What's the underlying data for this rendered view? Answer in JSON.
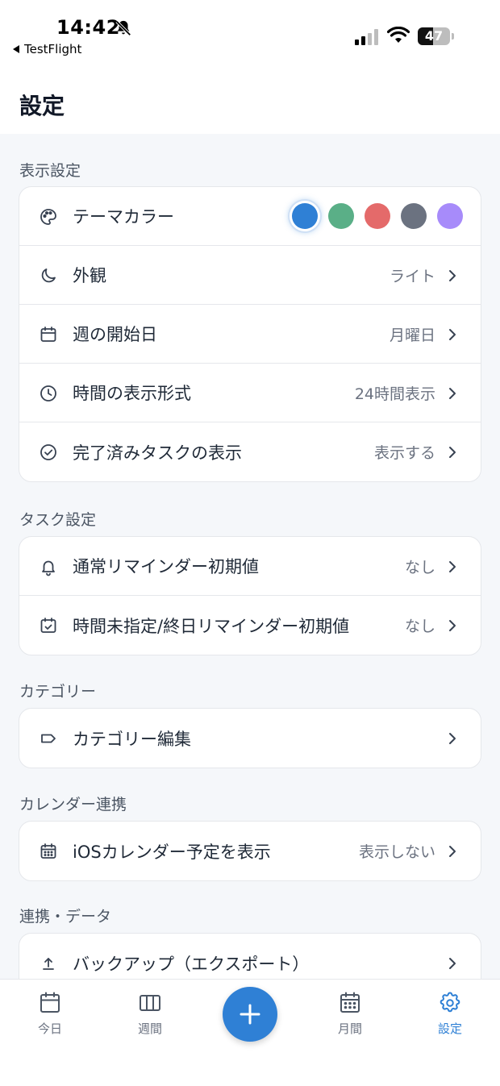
{
  "status_bar": {
    "time": "14:42",
    "back_app": "TestFlight",
    "battery_level": "47",
    "battery_fraction": 0.47
  },
  "header": {
    "title": "設定"
  },
  "sections": {
    "display": {
      "title": "表示設定",
      "theme_color": {
        "label": "テーマカラー",
        "icon": "palette-icon",
        "colors": [
          "#2f80d5",
          "#5aaf87",
          "#e46a6a",
          "#6b7280",
          "#a78bfa"
        ],
        "selected_index": 0
      },
      "appearance": {
        "label": "外観",
        "value": "ライト",
        "icon": "moon-icon"
      },
      "week_start": {
        "label": "週の開始日",
        "value": "月曜日",
        "icon": "calendar-icon"
      },
      "time_format": {
        "label": "時間の表示形式",
        "value": "24時間表示",
        "icon": "clock-icon"
      },
      "completed_tasks": {
        "label": "完了済みタスクの表示",
        "value": "表示する",
        "icon": "check-circle-icon"
      }
    },
    "task": {
      "title": "タスク設定",
      "reminder_default": {
        "label": "通常リマインダー初期値",
        "value": "なし",
        "icon": "bell-icon"
      },
      "allday_reminder_default": {
        "label": "時間未指定/終日リマインダー初期値",
        "value": "なし",
        "icon": "calendar-check-icon"
      }
    },
    "category": {
      "title": "カテゴリー",
      "edit": {
        "label": "カテゴリー編集",
        "icon": "tag-icon"
      }
    },
    "calendar": {
      "title": "カレンダー連携",
      "ios_calendar": {
        "label": "iOSカレンダー予定を表示",
        "value": "表示しない",
        "icon": "calendar-grid-icon"
      }
    },
    "data": {
      "title": "連携・データ",
      "backup": {
        "label": "バックアップ（エクスポート）",
        "icon": "upload-icon"
      }
    }
  },
  "tab_bar": {
    "accent": "#2f80d5",
    "today": {
      "label": "今日",
      "icon": "calendar-icon"
    },
    "week": {
      "label": "週間",
      "icon": "columns-icon"
    },
    "add": {
      "icon": "plus-icon"
    },
    "month": {
      "label": "月間",
      "icon": "calendar-grid-icon"
    },
    "settings": {
      "label": "設定",
      "icon": "gear-icon",
      "active": true
    }
  }
}
